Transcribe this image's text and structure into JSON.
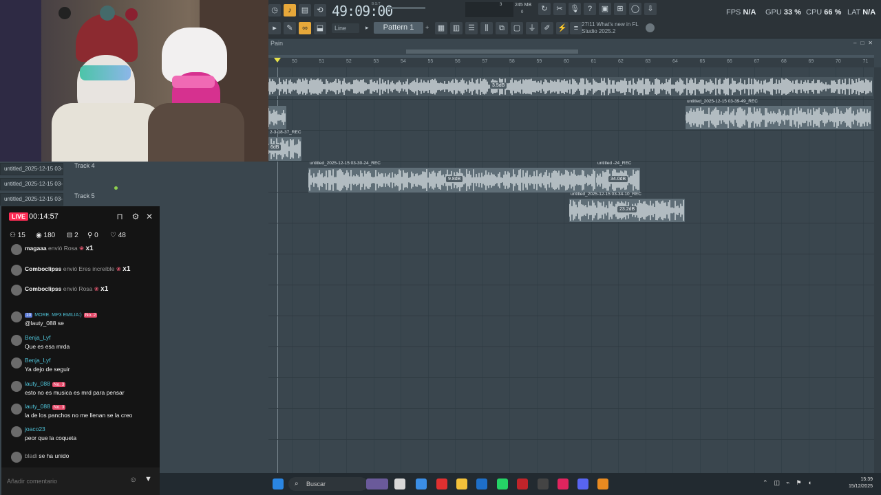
{
  "fl": {
    "time": "49:09:00",
    "time_sub": "B:S:T",
    "memory": "245 MB",
    "mem_a": "3",
    "mem_b": "0",
    "stats": {
      "fps_label": "FPS",
      "fps": "N/A",
      "gpu_label": "GPU",
      "gpu": "33 %",
      "cpu_label": "CPU",
      "cpu": "66 %",
      "lat_label": "LAT",
      "lat": "N/A"
    },
    "snap": "Line",
    "pattern": "Pattern 1",
    "news_line1": "27/11  What's new in FL",
    "news_line2": "Studio 2025.2",
    "playlist_title": "Pain",
    "ruler_ticks": [
      "50",
      "51",
      "52",
      "53",
      "54",
      "55",
      "56",
      "57",
      "58",
      "59",
      "60",
      "61",
      "62",
      "63",
      "64",
      "65",
      "66",
      "67",
      "68",
      "69",
      "70",
      "71"
    ],
    "clips": [
      {
        "name": "untitled_2025-12-15 03-39-49_REC",
        "db": ""
      },
      {
        "name": "2-3-18-37_REC",
        "db": ""
      },
      {
        "name": "untitled_2025-12-15 03-30-24_REC",
        "db": "9.8dB"
      },
      {
        "name": "untitled -24_REC",
        "db": "34.0dB"
      },
      {
        "name": "untitled_2025-12-15 03-34-10_REC",
        "db": "23.2dB"
      }
    ],
    "top_clip_db": "3.5dB",
    "left_clip_db": "6dB",
    "tracks": [
      {
        "clip": "untitled_2025-12-15 03-...",
        "name": "Track 4"
      },
      {
        "clip": "untitled_2025-12-15 03-...",
        "name": ""
      },
      {
        "clip": "untitled_2025-12-15 03-...",
        "name": "Track 5"
      }
    ]
  },
  "live": {
    "badge": "LIVE",
    "time": "00:14:57",
    "stats": {
      "users": "15",
      "views": "180",
      "gifts": "2",
      "shares": "0",
      "likes": "48"
    },
    "messages": [
      {
        "user": "magaaa",
        "verb": "envió Rosa",
        "count": "x1",
        "type": "gift"
      },
      {
        "user": "Comboclipss",
        "verb": "envió Eres increíble",
        "count": "x1",
        "type": "gift"
      },
      {
        "user": "Comboclipss",
        "verb": "envió Rosa",
        "count": "x1",
        "type": "gift"
      },
      {
        "user": "MORE. MP3 EMILIA:)",
        "badge": "No. 2",
        "level": "10",
        "text": "@lauty_088 se",
        "type": "chat"
      },
      {
        "user": "Benja_Lyf",
        "text": "Que es esa mrda",
        "type": "chat"
      },
      {
        "user": "Benja_Lyf",
        "text": "Ya dejo de seguir",
        "type": "chat"
      },
      {
        "user": "lauty_088",
        "badge": "No. 3",
        "text": "esto no es musica es mrd para pensar",
        "type": "chat"
      },
      {
        "user": "lauty_088",
        "badge": "No. 3",
        "text": "la de los panchos no me llenan se la creo",
        "type": "chat"
      },
      {
        "user": "joaco23",
        "text": "peor que la coqueta",
        "type": "chat"
      },
      {
        "user": "bladi",
        "verb": "se ha unido",
        "type": "join"
      }
    ],
    "comment_placeholder": "Añadir comentario"
  },
  "taskbar": {
    "search": "Buscar",
    "time": "15:39",
    "date": "15/12/2025"
  },
  "colors": {
    "accent": "#e7a83a",
    "live": "#fe2c55",
    "username": "#4fc3d8"
  }
}
